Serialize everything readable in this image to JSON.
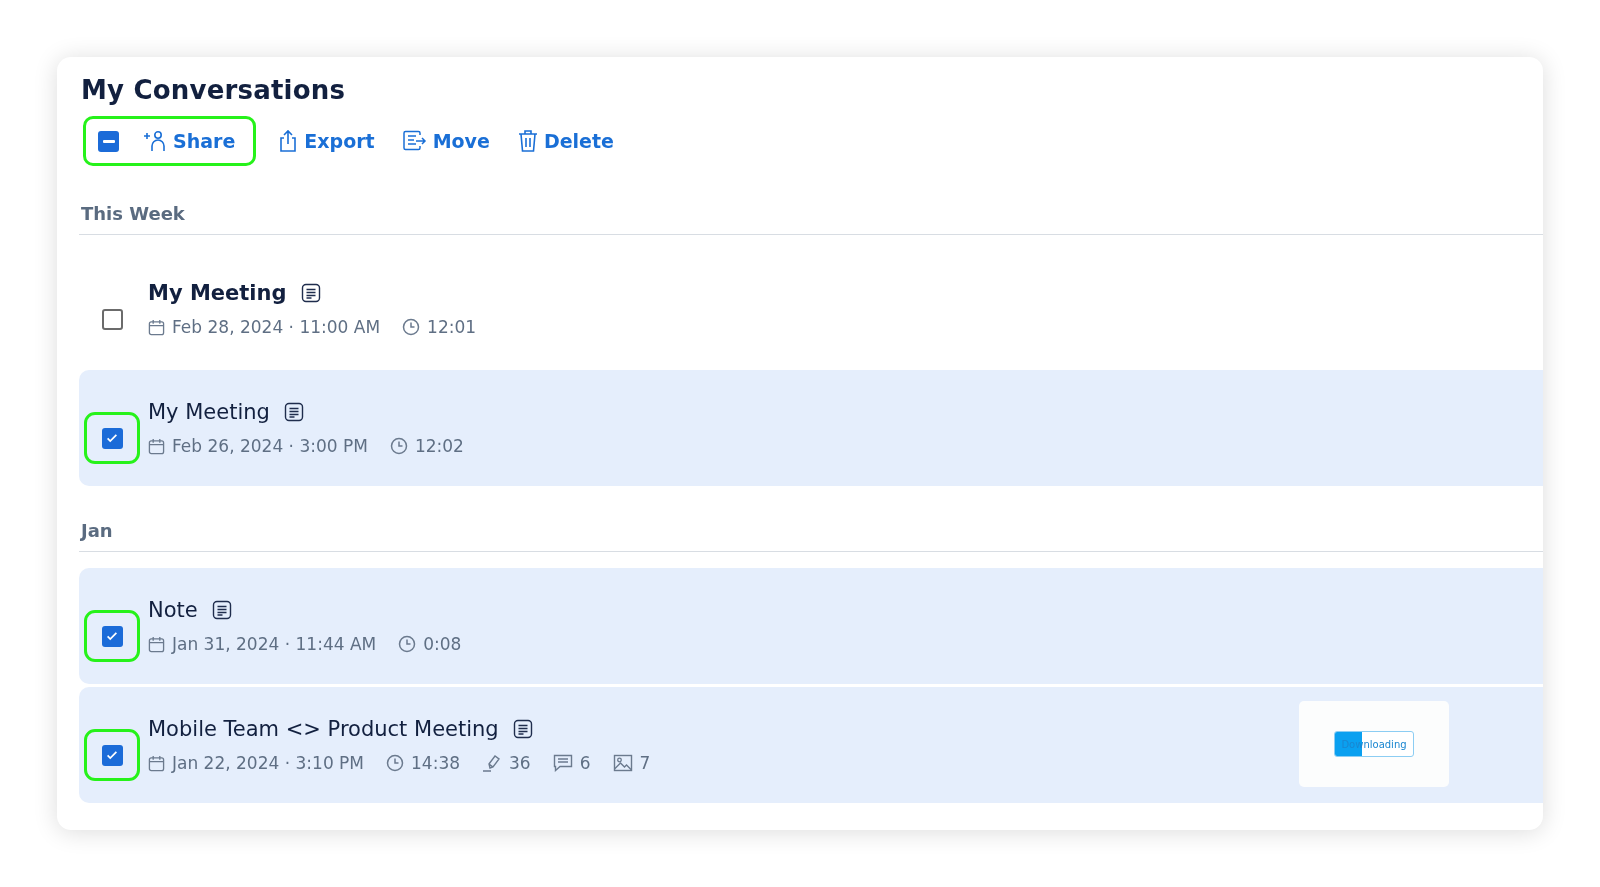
{
  "title": "My Conversations",
  "toolbar": {
    "select_all": {
      "indeterminate": true,
      "highlighted": true
    },
    "actions": [
      {
        "kind": "share",
        "label": "Share"
      },
      {
        "kind": "export",
        "label": "Export"
      },
      {
        "kind": "move",
        "label": "Move"
      },
      {
        "kind": "delete",
        "label": "Delete"
      }
    ]
  },
  "groups": [
    {
      "heading": "This Week",
      "items": [
        {
          "title": "My Meeting",
          "unread": true,
          "checked": false,
          "selected": false,
          "highlighted": false,
          "meta": [
            {
              "kind": "date",
              "text": "Feb 28, 2024 · 11:00 AM"
            },
            {
              "kind": "duration",
              "text": "12:01"
            }
          ]
        },
        {
          "title": "My Meeting",
          "unread": false,
          "checked": true,
          "selected": true,
          "highlighted": true,
          "meta": [
            {
              "kind": "date",
              "text": "Feb 26, 2024 · 3:00 PM"
            },
            {
              "kind": "duration",
              "text": "12:02"
            }
          ]
        }
      ]
    },
    {
      "heading": "Jan",
      "items": [
        {
          "title": "Note",
          "unread": false,
          "checked": true,
          "selected": true,
          "highlighted": true,
          "meta": [
            {
              "kind": "date",
              "text": "Jan 31, 2024 · 11:44 AM"
            },
            {
              "kind": "duration",
              "text": "0:08"
            }
          ]
        },
        {
          "title": "Mobile Team <> Product Meeting",
          "unread": false,
          "checked": true,
          "selected": true,
          "highlighted": true,
          "meta": [
            {
              "kind": "date",
              "text": "Jan 22, 2024 · 3:10 PM"
            },
            {
              "kind": "duration",
              "text": "14:38"
            },
            {
              "kind": "highlights",
              "text": "36"
            },
            {
              "kind": "comments",
              "text": "6"
            },
            {
              "kind": "images",
              "text": "7"
            }
          ],
          "download": {
            "label": "Downloading",
            "level": 0.35
          }
        }
      ]
    }
  ]
}
